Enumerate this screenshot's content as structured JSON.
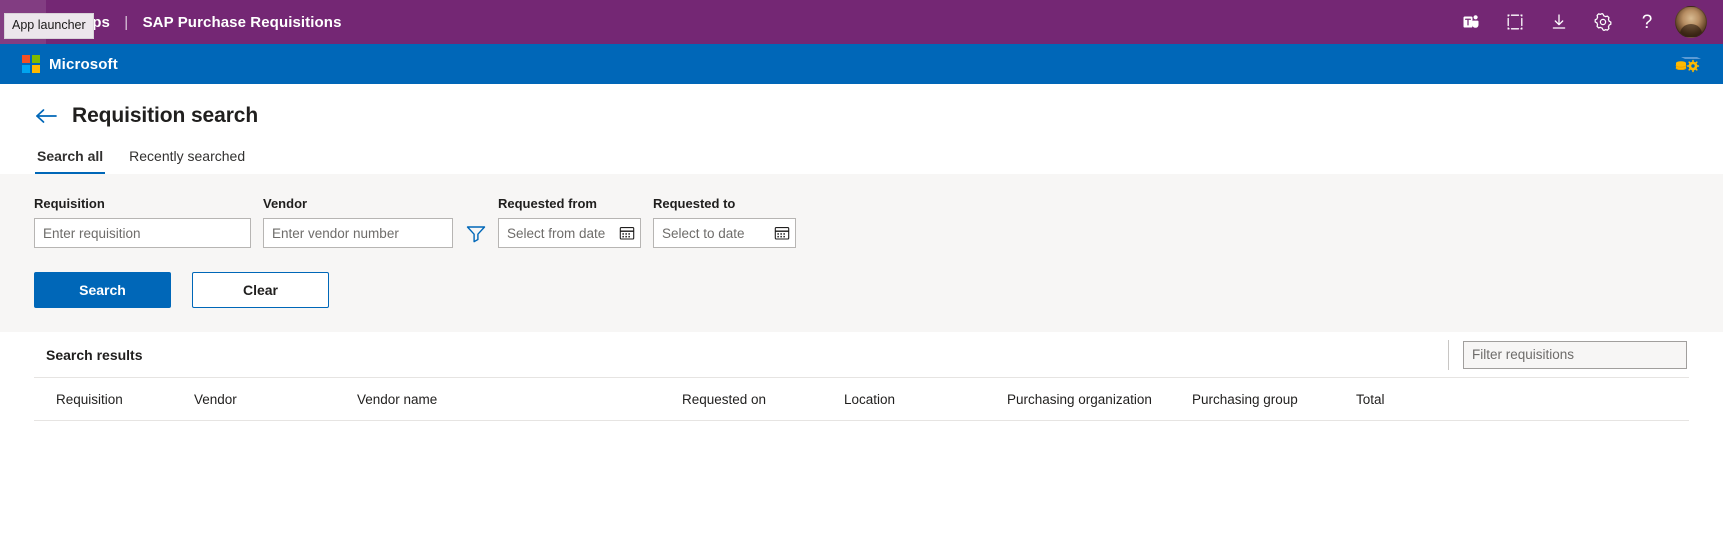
{
  "colors": {
    "top_bar": "#742774",
    "ms_bar": "#0067b8",
    "accent": "#0067b8",
    "panel_bg": "#f7f6f5",
    "page_bg": "#faf9f8"
  },
  "top_bar": {
    "app_launcher_icon": "waffle-icon",
    "app_name": "er Apps",
    "separator": "|",
    "page_app_title": "SAP Purchase Requisitions",
    "tooltip": "App launcher",
    "icons": [
      {
        "name": "teams-icon",
        "label": "Teams"
      },
      {
        "name": "screenshot-frame-icon",
        "label": "Capture"
      },
      {
        "name": "download-icon",
        "label": "Download"
      },
      {
        "name": "gear-icon",
        "label": "Settings"
      },
      {
        "name": "help-icon",
        "label": "?"
      }
    ],
    "avatar": "user-avatar"
  },
  "ms_bar": {
    "logo_text": "Microsoft",
    "logo_colors": [
      "#f25022",
      "#7fba00",
      "#00a4ef",
      "#ffb900"
    ],
    "right_icon": "data-settings-icon"
  },
  "page": {
    "back_icon": "back-arrow-icon",
    "title": "Requisition search"
  },
  "tabs": [
    {
      "label": "Search all",
      "active": true
    },
    {
      "label": "Recently searched",
      "active": false
    }
  ],
  "search_form": {
    "fields": [
      {
        "label": "Requisition",
        "placeholder": "Enter requisition",
        "value": ""
      },
      {
        "label": "Vendor",
        "placeholder": "Enter vendor number",
        "value": ""
      },
      {
        "label": "Requested from",
        "placeholder": "Select from date",
        "value": ""
      },
      {
        "label": "Requested to",
        "placeholder": "Select to date",
        "value": ""
      }
    ],
    "filter_icon": "funnel-filter-icon",
    "calendar_icon": "calendar-icon",
    "buttons": {
      "search_label": "Search",
      "clear_label": "Clear"
    }
  },
  "results": {
    "title": "Search results",
    "filter_placeholder": "Filter requisitions",
    "filter_value": "",
    "columns": [
      "Requisition",
      "Vendor",
      "Vendor name",
      "Requested on",
      "Location",
      "Purchasing organization",
      "Purchasing group",
      "Total"
    ],
    "rows": []
  }
}
